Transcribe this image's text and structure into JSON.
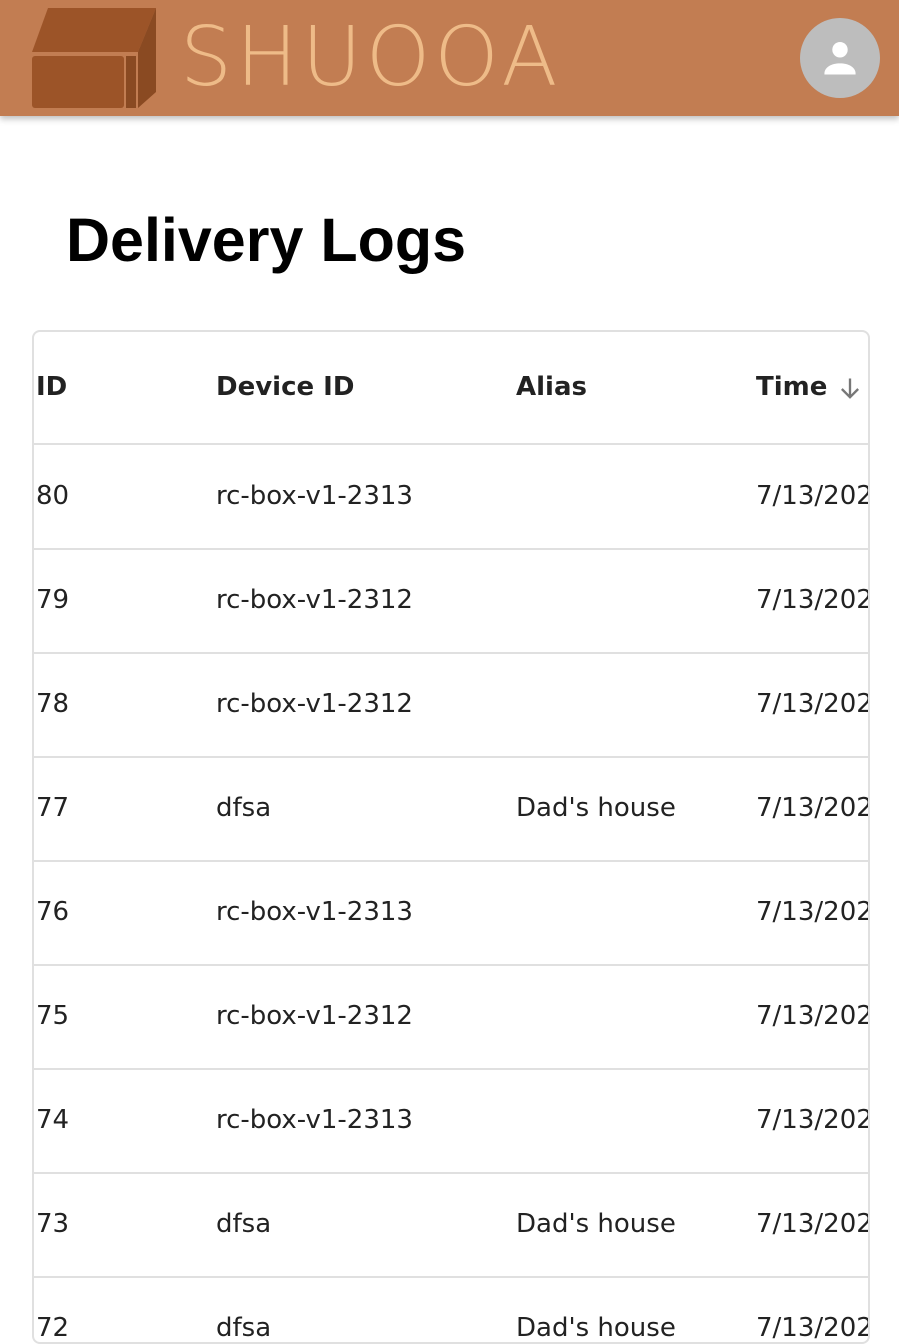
{
  "header": {
    "brand": "SHUOOA",
    "logo_icon": "open-box-icon",
    "profile_icon": "person-icon",
    "colors": {
      "bar": "#c27d52",
      "brand_text": "#eebb88",
      "logo": "#9c5428",
      "avatar": "#bdbdbd"
    }
  },
  "page": {
    "title": "Delivery Logs"
  },
  "table": {
    "columns": [
      {
        "label": "ID"
      },
      {
        "label": "Device ID"
      },
      {
        "label": "Alias"
      },
      {
        "label": "Time",
        "sort": "descending",
        "sort_icon": "arrow-down-icon"
      }
    ],
    "rows": [
      {
        "id": "80",
        "device_id": "rc-box-v1-2313",
        "alias": "",
        "time": "7/13/202"
      },
      {
        "id": "79",
        "device_id": "rc-box-v1-2312",
        "alias": "",
        "time": "7/13/202"
      },
      {
        "id": "78",
        "device_id": "rc-box-v1-2312",
        "alias": "",
        "time": "7/13/202"
      },
      {
        "id": "77",
        "device_id": "dfsa",
        "alias": "Dad's house",
        "time": "7/13/202"
      },
      {
        "id": "76",
        "device_id": "rc-box-v1-2313",
        "alias": "",
        "time": "7/13/202"
      },
      {
        "id": "75",
        "device_id": "rc-box-v1-2312",
        "alias": "",
        "time": "7/13/202"
      },
      {
        "id": "74",
        "device_id": "rc-box-v1-2313",
        "alias": "",
        "time": "7/13/202"
      },
      {
        "id": "73",
        "device_id": "dfsa",
        "alias": "Dad's house",
        "time": "7/13/202"
      },
      {
        "id": "72",
        "device_id": "dfsa",
        "alias": "Dad's house",
        "time": "7/13/202"
      }
    ]
  }
}
